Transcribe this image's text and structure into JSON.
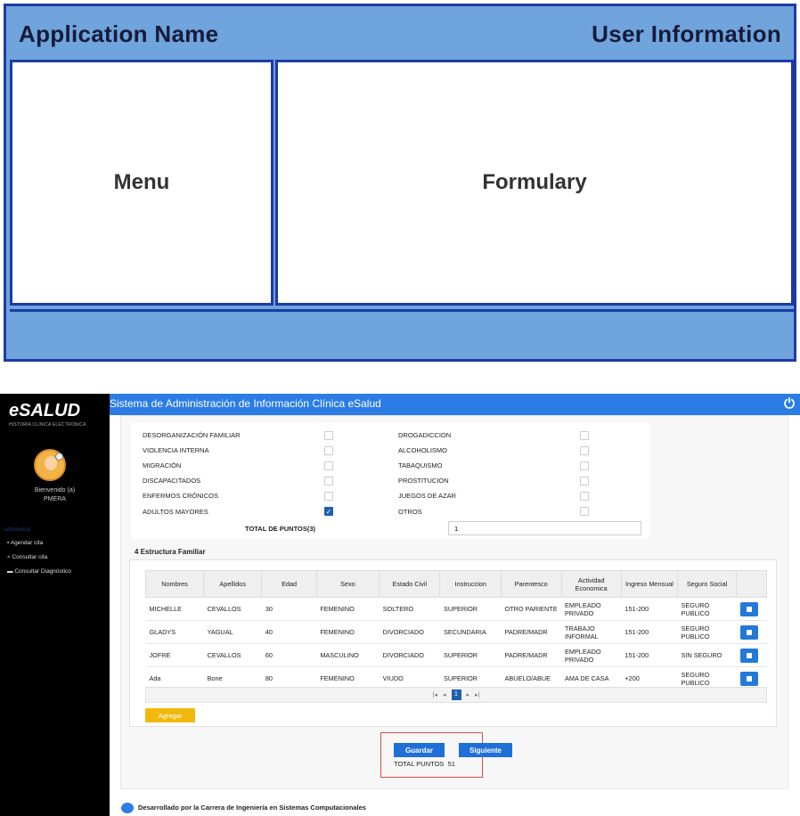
{
  "wireframe": {
    "app_name": "Application Name",
    "user_info": "User Information",
    "menu": "Menu",
    "formulary": "Formulary"
  },
  "app": {
    "logo": "eSALUD",
    "logo_sub": "HISTORIA CLINICA ELECTRONICA",
    "title": "Sistema de Administración de Información Clínica eSalud",
    "welcome_line1": "Bienvenido (a)",
    "welcome_user": "PMERA",
    "menu_section": "Administrar",
    "menu_items": [
      "Agendar cita",
      "Consultar cita",
      "Consultar Diagnóstico"
    ]
  },
  "risk_factors": {
    "left": [
      "DESORGANIZACIÓN FAMILIAR",
      "VIOLENCIA INTERNA",
      "MIGRACIÓN",
      "DISCAPACITADOS",
      "ENFERMOS CRÓNICOS",
      "ADULTOS MAYORES"
    ],
    "right": [
      "DROGADICCION",
      "ALCOHOLISMO",
      "TABAQUISMO",
      "PROSTITUCION",
      "JUEGOS DE AZAR",
      "OTROS"
    ],
    "total_label": "TOTAL DE PUNTOS(3)",
    "total_value": "1"
  },
  "family": {
    "section_title": "4 Estructura Familiar",
    "columns": [
      "Nombres",
      "Apellidos",
      "Edad",
      "Sexo",
      "Estado Civil",
      "Instruccion",
      "Parentesco",
      "Actividad Economica",
      "Ingreso Mensual",
      "Seguro Social"
    ],
    "rows": [
      [
        "MICHELLE",
        "CEVALLOS",
        "30",
        "FEMENINO",
        "SOLTERO",
        "SUPERIOR",
        "OTRO PARIENTE",
        "EMPLEADO PRIVADO",
        "151-200",
        "SEGURO PUBLICO"
      ],
      [
        "GLADYS",
        "YAGUAL",
        "40",
        "FEMENINO",
        "DIVORCIADO",
        "SECUNDARIA",
        "PADRE/MADR",
        "TRABAJO INFORMAL",
        "151-200",
        "SEGURO PUBLICO"
      ],
      [
        "JOFRE",
        "CEVALLOS",
        "60",
        "MASCULINO",
        "DIVORCIADO",
        "SUPERIOR",
        "PADRE/MADR",
        "EMPLEADO PRIVADO",
        "151-200",
        "SIN SEGURO"
      ],
      [
        "Ada",
        "Bone",
        "80",
        "FEMENINO",
        "VIUDO",
        "SUPERIOR",
        "ABUELO/ABUE",
        "AMA DE CASA",
        "+200",
        "SEGURO PUBLICO"
      ]
    ],
    "current_page": "1",
    "add_label": "Agregar"
  },
  "actions": {
    "save": "Guardar",
    "next": "Siguiente",
    "total_points_label": "TOTAL PUNTOS",
    "total_points_value": "51"
  },
  "footer": "Desarrollado por la Carrera de Ingeniería en Sistemas Computacionales"
}
